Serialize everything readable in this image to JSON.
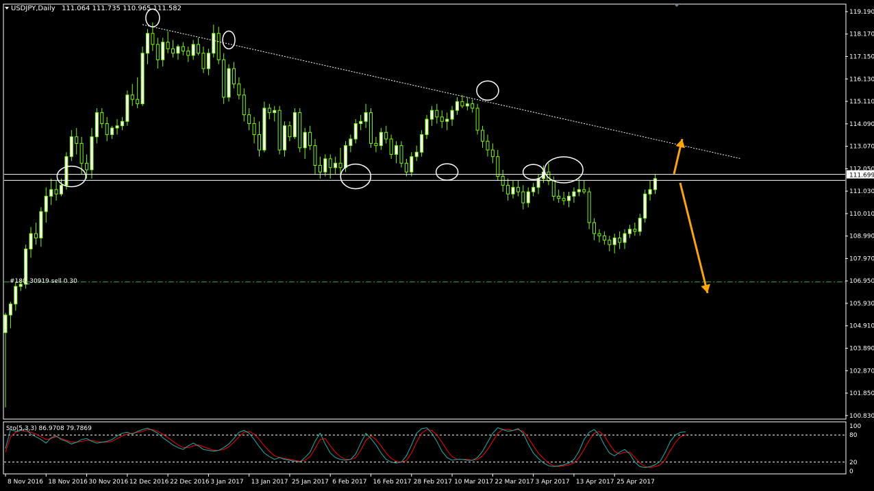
{
  "window": {
    "title": "USDJPY,Daily",
    "ohlc": "111.064 111.735 110.965 111.582"
  },
  "colors": {
    "background": "#000000",
    "frame": "#ffffff",
    "bull_candle": "#ffffff",
    "candle_wick": "#7cfc00",
    "trendline": "#ffffff",
    "current_price_line": "#ffffff",
    "order_line": "#3cb043",
    "annotation_arrow": "#ffa500",
    "stoch_main": "#20b2aa",
    "stoch_signal": "#ff0000",
    "price_tag_bg": "#ffffff",
    "price_tag_text": "#000000"
  },
  "order_label": "#180_30919 sell 0.30",
  "current_price_tag": "111.699",
  "stochastic": {
    "label": "Sto(5,3,3) 86.9708 79.7869",
    "scale_labels": [
      "100",
      "80",
      "20",
      "0"
    ],
    "levels": [
      80,
      20
    ],
    "main": [
      50,
      92,
      88,
      90,
      94,
      82,
      76,
      70,
      62,
      74,
      78,
      70,
      66,
      60,
      64,
      70,
      72,
      66,
      62,
      64,
      66,
      70,
      78,
      84,
      86,
      82,
      88,
      92,
      95,
      90,
      84,
      74,
      66,
      58,
      52,
      48,
      56,
      62,
      56,
      48,
      46,
      44,
      46,
      52,
      60,
      72,
      86,
      90,
      84,
      70,
      54,
      40,
      32,
      26,
      30,
      26,
      24,
      22,
      20,
      30,
      42,
      66,
      84,
      60,
      40,
      30,
      26,
      24,
      26,
      38,
      62,
      84,
      72,
      58,
      40,
      26,
      20,
      18,
      20,
      34,
      58,
      84,
      94,
      96,
      84,
      66,
      44,
      30,
      24,
      26,
      26,
      24,
      24,
      30,
      44,
      64,
      84,
      96,
      92,
      88,
      90,
      94,
      84,
      60,
      40,
      28,
      18,
      12,
      10,
      12,
      14,
      18,
      26,
      44,
      70,
      86,
      92,
      80,
      58,
      40,
      34,
      42,
      48,
      38,
      20,
      10,
      8,
      10,
      14,
      22,
      42,
      66,
      80,
      86,
      87
    ],
    "signal": [
      42,
      76,
      86,
      90,
      88,
      86,
      82,
      76,
      70,
      72,
      76,
      72,
      68,
      64,
      64,
      66,
      68,
      68,
      66,
      64,
      64,
      66,
      72,
      78,
      82,
      84,
      86,
      88,
      92,
      92,
      88,
      82,
      74,
      66,
      58,
      52,
      52,
      56,
      58,
      54,
      50,
      46,
      46,
      48,
      54,
      64,
      76,
      86,
      88,
      82,
      70,
      56,
      44,
      34,
      30,
      28,
      26,
      24,
      22,
      24,
      32,
      50,
      70,
      72,
      56,
      42,
      32,
      26,
      26,
      30,
      46,
      68,
      78,
      70,
      56,
      40,
      28,
      22,
      20,
      24,
      40,
      64,
      84,
      92,
      90,
      80,
      64,
      46,
      32,
      26,
      26,
      26,
      24,
      26,
      34,
      48,
      66,
      84,
      92,
      92,
      90,
      92,
      88,
      74,
      56,
      40,
      28,
      18,
      12,
      10,
      12,
      14,
      18,
      30,
      48,
      68,
      84,
      88,
      78,
      60,
      44,
      38,
      42,
      42,
      30,
      18,
      10,
      8,
      10,
      14,
      26,
      46,
      64,
      76,
      80
    ]
  },
  "chart_data": {
    "type": "candlestick",
    "symbol": "USDJPY",
    "timeframe": "Daily",
    "y_ticks": [
      "119.190",
      "118.170",
      "117.150",
      "116.130",
      "115.110",
      "114.090",
      "113.070",
      "112.050",
      "111.030",
      "110.010",
      "108.990",
      "107.970",
      "106.950",
      "105.930",
      "104.910",
      "103.890",
      "102.870",
      "101.850",
      "100.830"
    ],
    "ylim": [
      100.7,
      119.5
    ],
    "x_labels": [
      "8 Nov 2016",
      "18 Nov 2016",
      "30 Nov 2016",
      "12 Dec 2016",
      "22 Dec 2016",
      "3 Jan 2017",
      "13 Jan 2017",
      "25 Jan 2017",
      "6 Feb 2017",
      "16 Feb 2017",
      "28 Feb 2017",
      "10 Mar 2017",
      "22 Mar 2017",
      "3 Apr 2017",
      "13 Apr 2017",
      "25 Apr 2017"
    ],
    "x_label_bar_index": [
      0,
      8,
      16,
      24,
      32,
      40,
      48,
      56,
      64,
      72,
      80,
      88,
      96,
      104,
      112,
      120
    ],
    "candles": [
      {
        "o": 104.6,
        "h": 105.5,
        "l": 101.2,
        "c": 105.4
      },
      {
        "o": 105.4,
        "h": 106.0,
        "l": 104.8,
        "c": 105.9
      },
      {
        "o": 105.9,
        "h": 106.9,
        "l": 105.6,
        "c": 106.7
      },
      {
        "o": 106.7,
        "h": 107.0,
        "l": 106.5,
        "c": 106.8
      },
      {
        "o": 106.8,
        "h": 108.6,
        "l": 106.6,
        "c": 108.4
      },
      {
        "o": 108.4,
        "h": 109.4,
        "l": 108.0,
        "c": 109.1
      },
      {
        "o": 109.1,
        "h": 109.6,
        "l": 108.6,
        "c": 108.9
      },
      {
        "o": 108.9,
        "h": 110.3,
        "l": 108.5,
        "c": 110.1
      },
      {
        "o": 110.1,
        "h": 111.2,
        "l": 109.6,
        "c": 110.8
      },
      {
        "o": 110.8,
        "h": 111.6,
        "l": 110.4,
        "c": 111.1
      },
      {
        "o": 111.1,
        "h": 111.5,
        "l": 110.6,
        "c": 110.9
      },
      {
        "o": 110.9,
        "h": 111.6,
        "l": 110.8,
        "c": 111.3
      },
      {
        "o": 111.3,
        "h": 112.8,
        "l": 111.1,
        "c": 112.6
      },
      {
        "o": 112.6,
        "h": 113.8,
        "l": 112.4,
        "c": 113.5
      },
      {
        "o": 113.5,
        "h": 113.9,
        "l": 112.7,
        "c": 113.2
      },
      {
        "o": 113.2,
        "h": 113.5,
        "l": 111.8,
        "c": 112.3
      },
      {
        "o": 112.3,
        "h": 112.7,
        "l": 111.6,
        "c": 112.0
      },
      {
        "o": 112.0,
        "h": 113.9,
        "l": 111.6,
        "c": 113.5
      },
      {
        "o": 113.5,
        "h": 114.8,
        "l": 113.2,
        "c": 114.6
      },
      {
        "o": 114.6,
        "h": 114.8,
        "l": 113.9,
        "c": 114.1
      },
      {
        "o": 114.1,
        "h": 114.4,
        "l": 113.3,
        "c": 113.6
      },
      {
        "o": 113.6,
        "h": 114.0,
        "l": 113.4,
        "c": 113.9
      },
      {
        "o": 113.9,
        "h": 114.3,
        "l": 113.6,
        "c": 114.0
      },
      {
        "o": 114.0,
        "h": 114.4,
        "l": 113.8,
        "c": 114.2
      },
      {
        "o": 114.2,
        "h": 115.6,
        "l": 114.0,
        "c": 115.4
      },
      {
        "o": 115.4,
        "h": 115.9,
        "l": 114.9,
        "c": 115.2
      },
      {
        "o": 115.2,
        "h": 116.2,
        "l": 114.8,
        "c": 115.0
      },
      {
        "o": 115.0,
        "h": 117.6,
        "l": 114.9,
        "c": 117.3
      },
      {
        "o": 117.3,
        "h": 118.4,
        "l": 116.8,
        "c": 118.2
      },
      {
        "o": 118.2,
        "h": 118.7,
        "l": 117.4,
        "c": 117.7
      },
      {
        "o": 117.7,
        "h": 118.0,
        "l": 116.6,
        "c": 117.0
      },
      {
        "o": 117.0,
        "h": 118.0,
        "l": 116.7,
        "c": 117.8
      },
      {
        "o": 117.8,
        "h": 118.3,
        "l": 117.3,
        "c": 117.5
      },
      {
        "o": 117.5,
        "h": 117.9,
        "l": 117.1,
        "c": 117.3
      },
      {
        "o": 117.3,
        "h": 117.7,
        "l": 117.0,
        "c": 117.6
      },
      {
        "o": 117.6,
        "h": 117.8,
        "l": 117.2,
        "c": 117.4
      },
      {
        "o": 117.4,
        "h": 117.6,
        "l": 116.9,
        "c": 117.2
      },
      {
        "o": 117.2,
        "h": 117.9,
        "l": 117.0,
        "c": 117.7
      },
      {
        "o": 117.7,
        "h": 118.0,
        "l": 117.2,
        "c": 117.3
      },
      {
        "o": 117.3,
        "h": 117.6,
        "l": 116.4,
        "c": 116.6
      },
      {
        "o": 116.6,
        "h": 117.5,
        "l": 116.3,
        "c": 117.3
      },
      {
        "o": 117.3,
        "h": 118.6,
        "l": 117.1,
        "c": 118.2
      },
      {
        "o": 118.2,
        "h": 118.5,
        "l": 116.8,
        "c": 117.0
      },
      {
        "o": 117.0,
        "h": 117.3,
        "l": 115.0,
        "c": 115.3
      },
      {
        "o": 115.3,
        "h": 116.8,
        "l": 115.1,
        "c": 116.6
      },
      {
        "o": 116.6,
        "h": 116.9,
        "l": 115.7,
        "c": 115.9
      },
      {
        "o": 115.9,
        "h": 116.2,
        "l": 115.2,
        "c": 115.4
      },
      {
        "o": 115.4,
        "h": 115.7,
        "l": 114.2,
        "c": 114.5
      },
      {
        "o": 114.5,
        "h": 114.8,
        "l": 113.8,
        "c": 114.1
      },
      {
        "o": 114.1,
        "h": 114.4,
        "l": 113.2,
        "c": 113.6
      },
      {
        "o": 113.6,
        "h": 114.2,
        "l": 112.6,
        "c": 112.9
      },
      {
        "o": 112.9,
        "h": 115.1,
        "l": 112.8,
        "c": 114.8
      },
      {
        "o": 114.8,
        "h": 115.0,
        "l": 114.3,
        "c": 114.6
      },
      {
        "o": 114.6,
        "h": 114.9,
        "l": 114.2,
        "c": 114.7
      },
      {
        "o": 114.7,
        "h": 114.9,
        "l": 112.7,
        "c": 112.9
      },
      {
        "o": 112.9,
        "h": 114.2,
        "l": 112.6,
        "c": 114.0
      },
      {
        "o": 114.0,
        "h": 114.2,
        "l": 113.3,
        "c": 113.5
      },
      {
        "o": 113.5,
        "h": 114.8,
        "l": 113.4,
        "c": 114.6
      },
      {
        "o": 114.6,
        "h": 114.8,
        "l": 112.8,
        "c": 113.0
      },
      {
        "o": 113.0,
        "h": 113.9,
        "l": 112.5,
        "c": 113.7
      },
      {
        "o": 113.7,
        "h": 114.0,
        "l": 112.9,
        "c": 113.1
      },
      {
        "o": 113.1,
        "h": 113.4,
        "l": 111.8,
        "c": 112.2
      },
      {
        "o": 112.2,
        "h": 112.6,
        "l": 111.6,
        "c": 111.9
      },
      {
        "o": 111.9,
        "h": 112.7,
        "l": 111.7,
        "c": 112.5
      },
      {
        "o": 112.5,
        "h": 112.7,
        "l": 111.6,
        "c": 112.1
      },
      {
        "o": 112.1,
        "h": 112.6,
        "l": 111.8,
        "c": 112.3
      },
      {
        "o": 112.3,
        "h": 113.0,
        "l": 111.8,
        "c": 112.1
      },
      {
        "o": 112.1,
        "h": 113.3,
        "l": 111.9,
        "c": 113.1
      },
      {
        "o": 113.1,
        "h": 113.6,
        "l": 112.8,
        "c": 113.4
      },
      {
        "o": 113.4,
        "h": 114.3,
        "l": 113.2,
        "c": 114.1
      },
      {
        "o": 114.1,
        "h": 114.5,
        "l": 113.8,
        "c": 114.2
      },
      {
        "o": 114.2,
        "h": 115.0,
        "l": 113.9,
        "c": 114.6
      },
      {
        "o": 114.6,
        "h": 114.8,
        "l": 113.0,
        "c": 113.2
      },
      {
        "o": 113.2,
        "h": 113.5,
        "l": 112.8,
        "c": 113.1
      },
      {
        "o": 113.1,
        "h": 113.9,
        "l": 112.9,
        "c": 113.7
      },
      {
        "o": 113.7,
        "h": 114.0,
        "l": 113.2,
        "c": 113.4
      },
      {
        "o": 113.4,
        "h": 113.6,
        "l": 112.5,
        "c": 112.7
      },
      {
        "o": 112.7,
        "h": 113.3,
        "l": 112.3,
        "c": 113.1
      },
      {
        "o": 113.1,
        "h": 113.3,
        "l": 112.1,
        "c": 112.3
      },
      {
        "o": 112.3,
        "h": 112.5,
        "l": 111.7,
        "c": 111.9
      },
      {
        "o": 111.9,
        "h": 112.8,
        "l": 111.7,
        "c": 112.6
      },
      {
        "o": 112.6,
        "h": 113.1,
        "l": 112.4,
        "c": 112.8
      },
      {
        "o": 112.8,
        "h": 113.8,
        "l": 112.6,
        "c": 113.6
      },
      {
        "o": 113.6,
        "h": 114.5,
        "l": 113.4,
        "c": 114.3
      },
      {
        "o": 114.3,
        "h": 114.9,
        "l": 114.0,
        "c": 114.7
      },
      {
        "o": 114.7,
        "h": 115.0,
        "l": 114.1,
        "c": 114.4
      },
      {
        "o": 114.4,
        "h": 114.7,
        "l": 113.9,
        "c": 114.2
      },
      {
        "o": 114.2,
        "h": 114.6,
        "l": 113.8,
        "c": 114.3
      },
      {
        "o": 114.3,
        "h": 114.9,
        "l": 114.0,
        "c": 114.7
      },
      {
        "o": 114.7,
        "h": 115.3,
        "l": 114.5,
        "c": 115.1
      },
      {
        "o": 115.1,
        "h": 115.4,
        "l": 114.8,
        "c": 114.9
      },
      {
        "o": 114.9,
        "h": 115.3,
        "l": 114.7,
        "c": 115.0
      },
      {
        "o": 115.0,
        "h": 115.2,
        "l": 114.6,
        "c": 114.8
      },
      {
        "o": 114.8,
        "h": 115.0,
        "l": 113.6,
        "c": 113.8
      },
      {
        "o": 113.8,
        "h": 114.0,
        "l": 113.0,
        "c": 113.3
      },
      {
        "o": 113.3,
        "h": 113.6,
        "l": 112.6,
        "c": 112.9
      },
      {
        "o": 112.9,
        "h": 113.2,
        "l": 112.3,
        "c": 112.6
      },
      {
        "o": 112.6,
        "h": 112.9,
        "l": 111.5,
        "c": 111.7
      },
      {
        "o": 111.7,
        "h": 112.0,
        "l": 111.0,
        "c": 111.3
      },
      {
        "o": 111.3,
        "h": 111.6,
        "l": 110.6,
        "c": 110.9
      },
      {
        "o": 110.9,
        "h": 111.5,
        "l": 110.7,
        "c": 111.2
      },
      {
        "o": 111.2,
        "h": 111.5,
        "l": 110.8,
        "c": 111.0
      },
      {
        "o": 111.0,
        "h": 111.3,
        "l": 110.2,
        "c": 110.5
      },
      {
        "o": 110.5,
        "h": 111.2,
        "l": 110.3,
        "c": 111.0
      },
      {
        "o": 111.0,
        "h": 111.4,
        "l": 110.8,
        "c": 111.2
      },
      {
        "o": 111.2,
        "h": 111.8,
        "l": 110.9,
        "c": 111.6
      },
      {
        "o": 111.6,
        "h": 112.2,
        "l": 111.4,
        "c": 111.9
      },
      {
        "o": 111.9,
        "h": 112.3,
        "l": 111.3,
        "c": 111.5
      },
      {
        "o": 111.5,
        "h": 111.7,
        "l": 110.6,
        "c": 110.8
      },
      {
        "o": 110.8,
        "h": 111.1,
        "l": 110.5,
        "c": 110.7
      },
      {
        "o": 110.7,
        "h": 111.0,
        "l": 110.4,
        "c": 110.6
      },
      {
        "o": 110.6,
        "h": 111.0,
        "l": 110.3,
        "c": 110.8
      },
      {
        "o": 110.8,
        "h": 111.2,
        "l": 110.5,
        "c": 111.0
      },
      {
        "o": 111.0,
        "h": 111.6,
        "l": 110.8,
        "c": 111.1
      },
      {
        "o": 111.1,
        "h": 111.5,
        "l": 110.9,
        "c": 111.0
      },
      {
        "o": 111.0,
        "h": 111.2,
        "l": 109.3,
        "c": 109.6
      },
      {
        "o": 109.6,
        "h": 109.8,
        "l": 108.8,
        "c": 109.1
      },
      {
        "o": 109.1,
        "h": 109.3,
        "l": 108.7,
        "c": 109.0
      },
      {
        "o": 109.0,
        "h": 109.2,
        "l": 108.6,
        "c": 108.8
      },
      {
        "o": 108.8,
        "h": 109.0,
        "l": 108.3,
        "c": 108.6
      },
      {
        "o": 108.6,
        "h": 109.1,
        "l": 108.2,
        "c": 108.9
      },
      {
        "o": 108.9,
        "h": 109.2,
        "l": 108.4,
        "c": 108.7
      },
      {
        "o": 108.7,
        "h": 109.3,
        "l": 108.4,
        "c": 109.1
      },
      {
        "o": 109.1,
        "h": 109.5,
        "l": 108.9,
        "c": 109.3
      },
      {
        "o": 109.3,
        "h": 109.6,
        "l": 109.0,
        "c": 109.2
      },
      {
        "o": 109.2,
        "h": 110.0,
        "l": 109.0,
        "c": 109.8
      },
      {
        "o": 109.8,
        "h": 111.1,
        "l": 109.6,
        "c": 110.9
      },
      {
        "o": 110.9,
        "h": 111.5,
        "l": 110.6,
        "c": 111.1
      },
      {
        "o": 111.1,
        "h": 111.8,
        "l": 110.9,
        "c": 111.6
      }
    ],
    "trendline": [
      {
        "bar": 27,
        "price": 118.6
      },
      {
        "bar": 145,
        "price": 112.5
      }
    ],
    "current_price": 111.582,
    "current_price_tag": 111.699,
    "order_level": 106.9,
    "grid": false
  }
}
